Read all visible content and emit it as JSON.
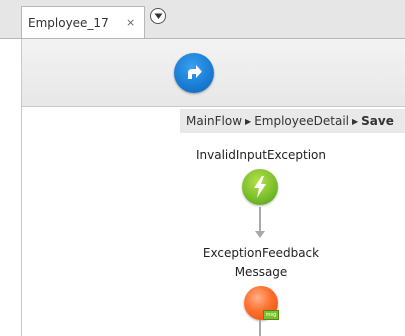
{
  "tabs": [
    {
      "label": "Employee_17",
      "close_glyph": "×"
    }
  ],
  "breadcrumb": {
    "items": [
      "MainFlow",
      "EmployeeDetail"
    ],
    "current": "Save"
  },
  "nodes": {
    "exception_handler": {
      "label": "InvalidInputException"
    },
    "feedback_message": {
      "label_line1": "ExceptionFeedback",
      "label_line2": "Message"
    },
    "badge_text": "msg"
  }
}
